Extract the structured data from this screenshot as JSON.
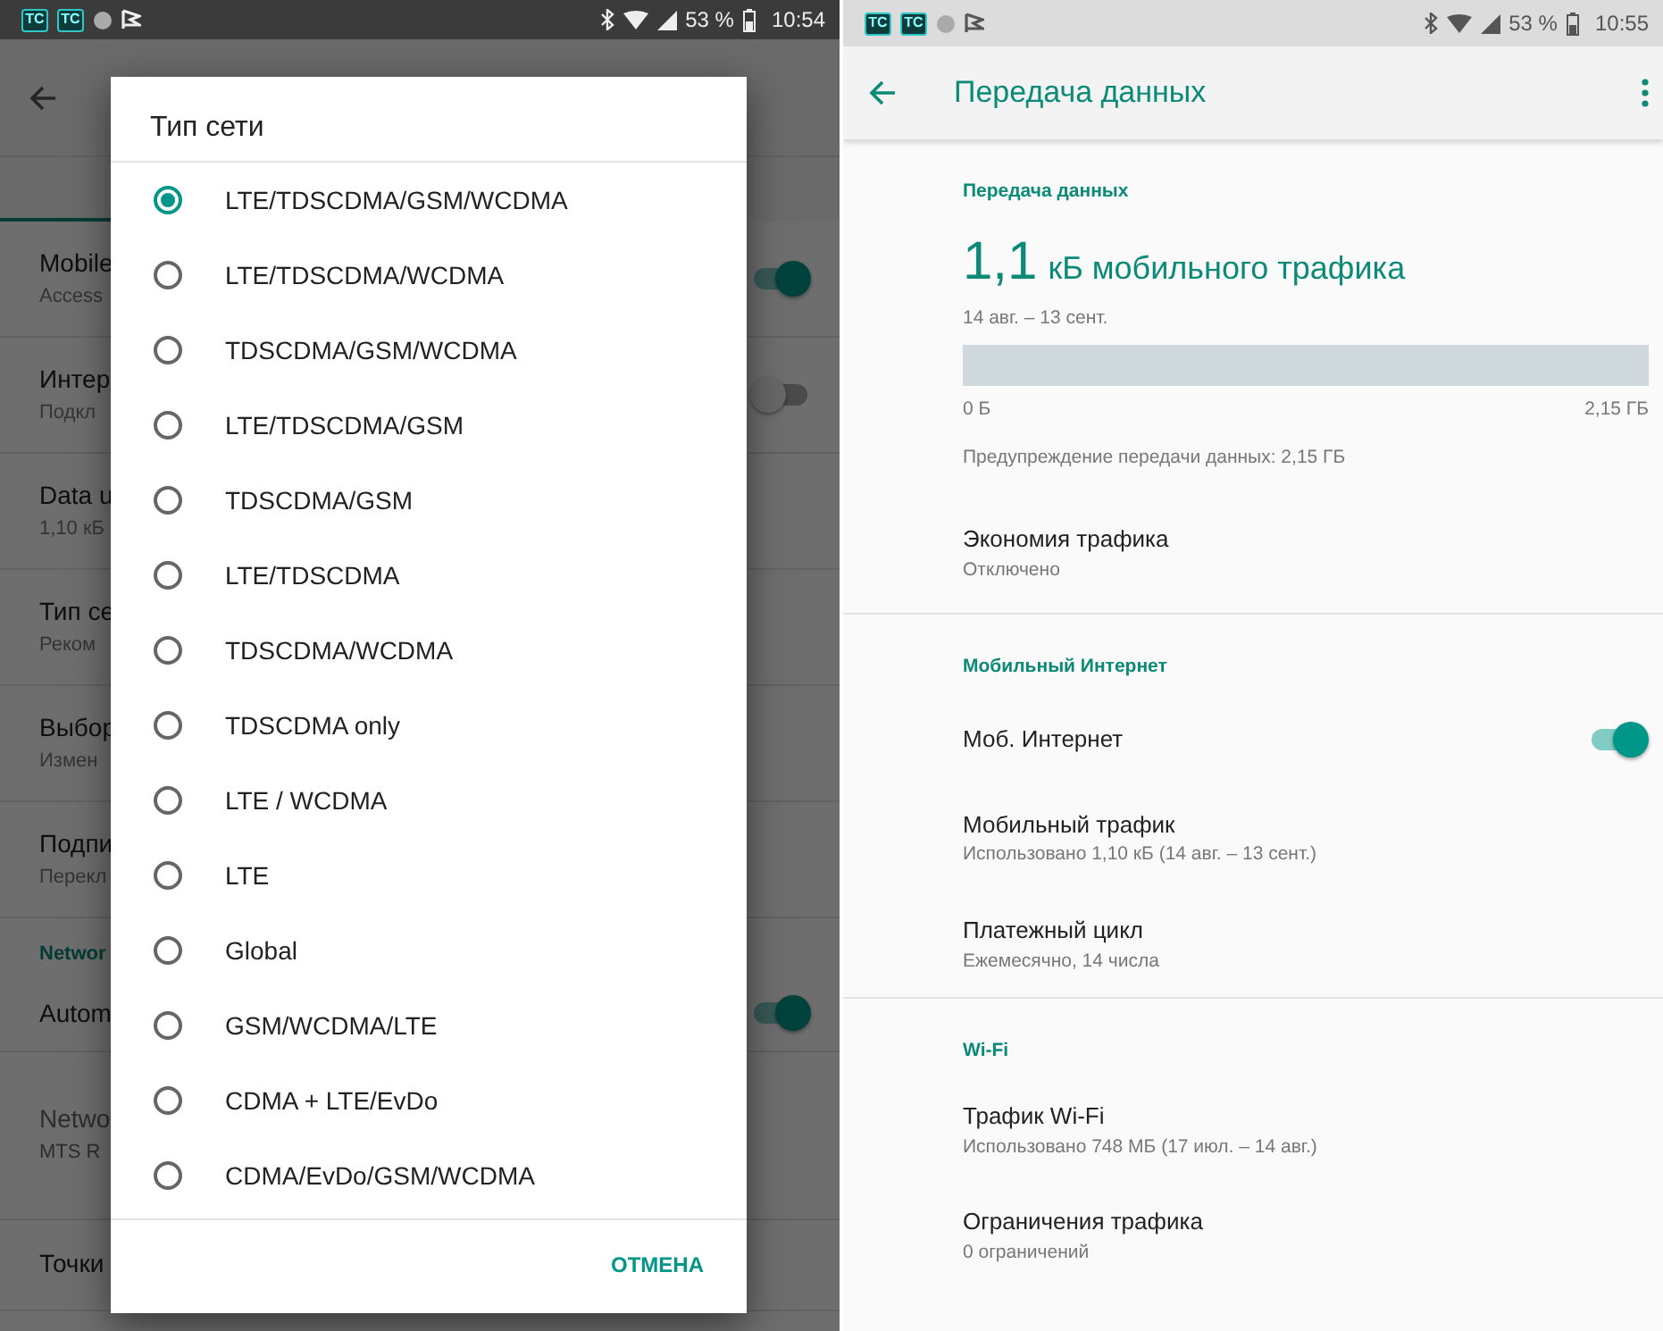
{
  "left_screen": {
    "status_bar": {
      "app_icons": [
        "TC",
        "TC"
      ],
      "battery": "53 %",
      "time": "10:54"
    },
    "background_items": [
      {
        "title": "Mobile",
        "subtitle": "Access",
        "on": true
      },
      {
        "title": "Интер",
        "subtitle": "Подкл",
        "on": false
      },
      {
        "title": "Data u",
        "subtitle": "1,10 кБ"
      },
      {
        "title": "Тип се",
        "subtitle": "Реком"
      },
      {
        "title": "Выбор",
        "subtitle": "Измен"
      },
      {
        "title": "Подпи",
        "subtitle": "Перекл"
      }
    ],
    "background_section": "Networ",
    "background_items_2": [
      {
        "title": "Autom",
        "on": true,
        "disabled": false
      },
      {
        "title": "Netwo",
        "subtitle": "MTS R",
        "disabled": true
      },
      {
        "title": "Точки",
        "disabled": false
      }
    ],
    "dialog": {
      "title": "Тип сети",
      "options": [
        {
          "label": "LTE/TDSCDMA/GSM/WCDMA",
          "selected": true
        },
        {
          "label": "LTE/TDSCDMA/WCDMA",
          "selected": false
        },
        {
          "label": "TDSCDMA/GSM/WCDMA",
          "selected": false
        },
        {
          "label": "LTE/TDSCDMA/GSM",
          "selected": false
        },
        {
          "label": "TDSCDMA/GSM",
          "selected": false
        },
        {
          "label": "LTE/TDSCDMA",
          "selected": false
        },
        {
          "label": "TDSCDMA/WCDMA",
          "selected": false
        },
        {
          "label": "TDSCDMA only",
          "selected": false
        },
        {
          "label": "LTE / WCDMA",
          "selected": false
        },
        {
          "label": "LTE",
          "selected": false
        },
        {
          "label": "Global",
          "selected": false
        },
        {
          "label": "GSM/WCDMA/LTE",
          "selected": false
        },
        {
          "label": "CDMA + LTE/EvDo",
          "selected": false
        },
        {
          "label": "CDMA/EvDo/GSM/WCDMA",
          "selected": false
        }
      ],
      "cancel": "ОТМЕНА"
    }
  },
  "right_screen": {
    "status_bar": {
      "app_icons": [
        "TC",
        "TC"
      ],
      "battery": "53 %",
      "time": "10:55"
    },
    "toolbar": {
      "title": "Передача данных"
    },
    "usage": {
      "header": "Передача данных",
      "amount": "1,1",
      "amount_unit": "кБ мобильного трафика",
      "period": "14 авг. – 13 сент.",
      "min_label": "0 Б",
      "max_label": "2,15 ГБ",
      "warning": "Предупреждение передачи данных: 2,15 ГБ"
    },
    "sections": [
      {
        "items": [
          {
            "title": "Экономия трафика",
            "subtitle": "Отключено"
          }
        ]
      },
      {
        "header": "Мобильный Интернет",
        "items": [
          {
            "title": "Моб. Интернет",
            "on": true
          },
          {
            "title": "Мобильный трафик",
            "subtitle": "Использовано 1,10 кБ (14 авг. – 13 сент.)"
          },
          {
            "title": "Платежный цикл",
            "subtitle": "Ежемесячно, 14 числа"
          }
        ]
      },
      {
        "header": "Wi-Fi",
        "items": [
          {
            "title": "Трафик Wi-Fi",
            "subtitle": "Использовано 748 МБ (17 июл. – 14 авг.)"
          },
          {
            "title": "Ограничения трафика",
            "subtitle": "0 ограничений"
          }
        ]
      }
    ]
  }
}
